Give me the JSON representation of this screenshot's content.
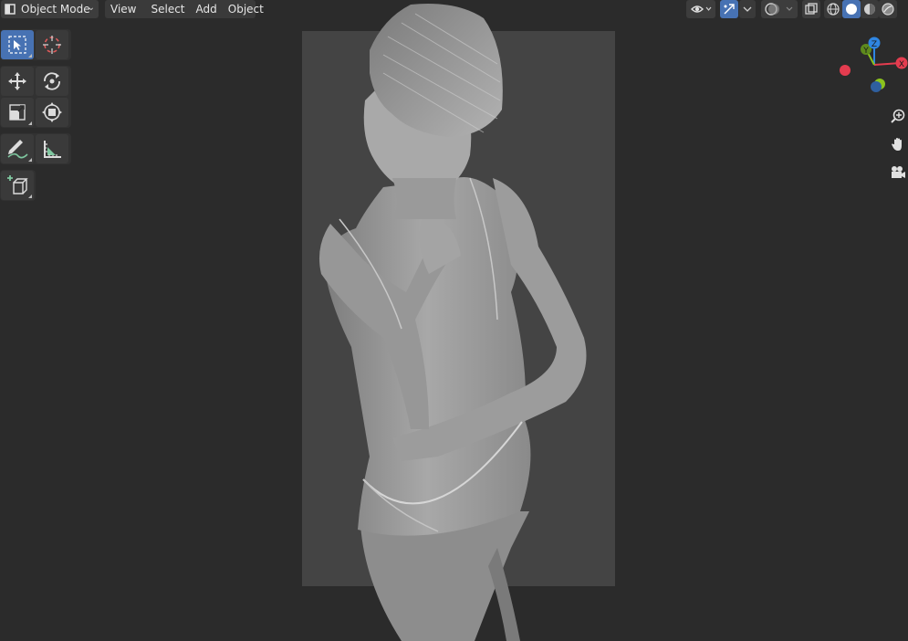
{
  "header": {
    "mode_label": "Object Mode",
    "menu": [
      "View",
      "Select",
      "Add",
      "Object"
    ]
  },
  "toolbar": {
    "tools": [
      {
        "name": "select-box-tool",
        "icon": "select-box-icon",
        "active": true
      },
      {
        "name": "cursor-tool",
        "icon": "cursor-icon",
        "active": false
      },
      {
        "name": "move-tool",
        "icon": "move-icon",
        "active": false
      },
      {
        "name": "rotate-tool",
        "icon": "rotate-icon",
        "active": false
      },
      {
        "name": "scale-tool",
        "icon": "scale-icon",
        "active": false
      },
      {
        "name": "transform-tool",
        "icon": "transform-icon",
        "active": false
      },
      {
        "name": "annotate-tool",
        "icon": "annotate-icon",
        "active": false
      },
      {
        "name": "measure-tool",
        "icon": "measure-icon",
        "active": false
      },
      {
        "name": "add-cube-tool",
        "icon": "add-cube-icon",
        "active": false
      }
    ]
  },
  "gizmo": {
    "axes": {
      "x": "X",
      "y": "Y",
      "z": "Z"
    },
    "colors": {
      "x": "#e43c4f",
      "y": "#8bc21d",
      "z": "#2f86e2"
    }
  },
  "shading": {
    "active": "solid"
  },
  "colors": {
    "accent": "#4772b3",
    "background": "#2b2b2b",
    "camera_frame": "#444444"
  }
}
